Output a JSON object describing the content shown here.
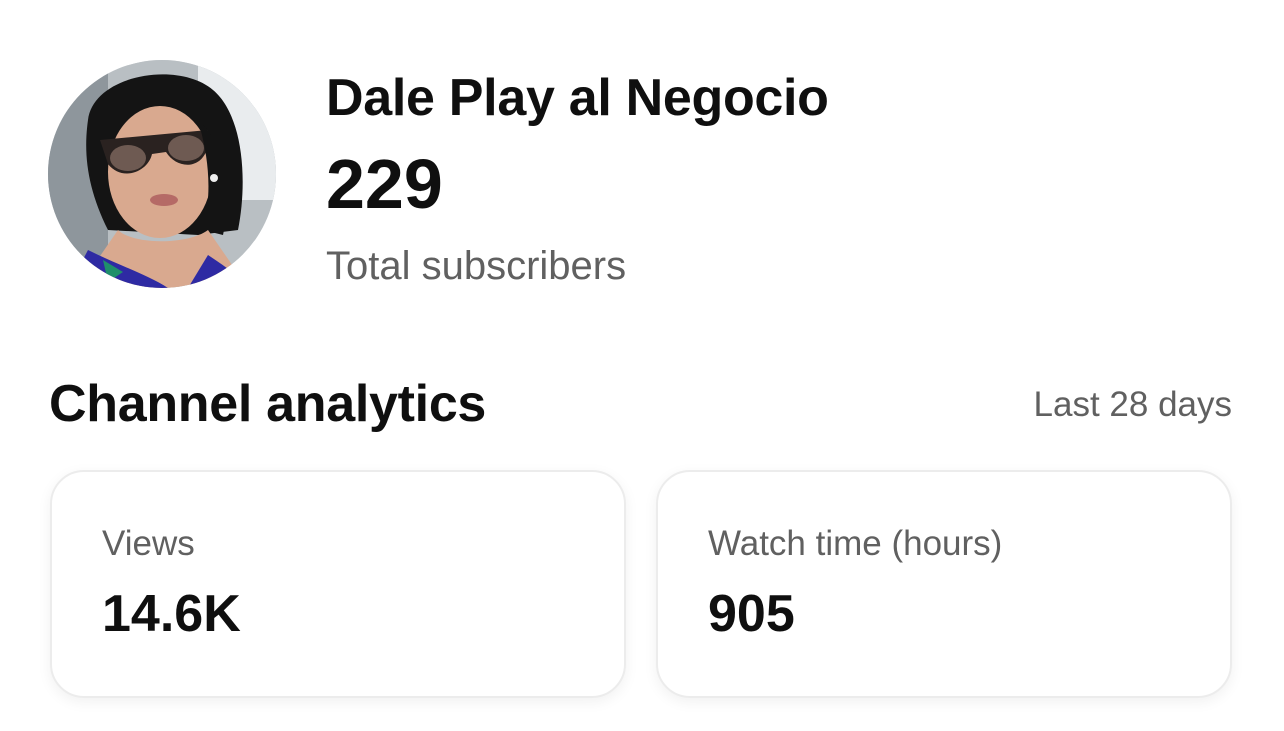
{
  "channel": {
    "name": "Dale Play al Negocio",
    "subscriber_count": "229",
    "subscriber_label": "Total subscribers",
    "avatar_icon": "channel-avatar-photo"
  },
  "analytics": {
    "title": "Channel analytics",
    "period": "Last 28 days",
    "cards": [
      {
        "label": "Views",
        "value": "14.6K"
      },
      {
        "label": "Watch time (hours)",
        "value": "905"
      }
    ]
  },
  "colors": {
    "primary_text": "#0f0f0f",
    "secondary_text": "#606060",
    "card_border": "#ececec",
    "background": "#ffffff"
  }
}
